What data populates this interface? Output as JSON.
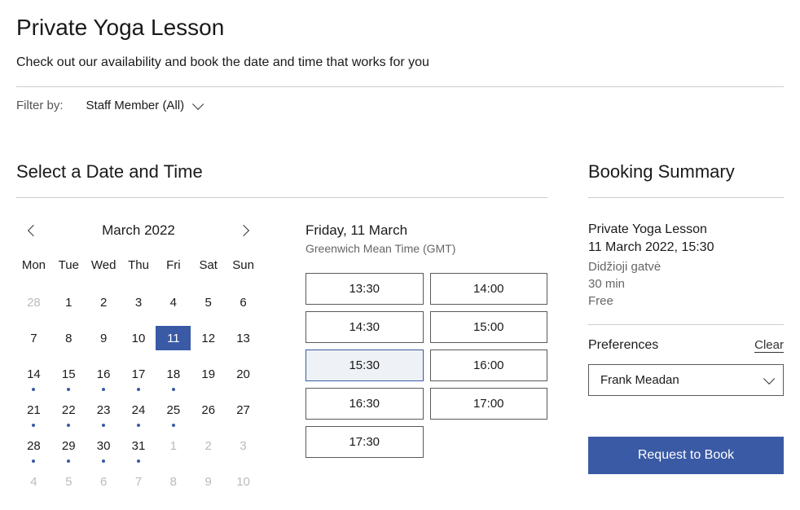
{
  "header": {
    "title": "Private Yoga Lesson",
    "subtitle": "Check out our availability and book the date and time that works for you"
  },
  "filter": {
    "label": "Filter by:",
    "value": "Staff Member (All)"
  },
  "sections": {
    "select_dt": "Select a Date and Time",
    "summary": "Booking Summary"
  },
  "calendar": {
    "month_year": "March  2022",
    "weekdays": [
      "Mon",
      "Tue",
      "Wed",
      "Thu",
      "Fri",
      "Sat",
      "Sun"
    ],
    "days": [
      {
        "n": "28",
        "muted": true
      },
      {
        "n": "1"
      },
      {
        "n": "2"
      },
      {
        "n": "3"
      },
      {
        "n": "4"
      },
      {
        "n": "5"
      },
      {
        "n": "6"
      },
      {
        "n": "7"
      },
      {
        "n": "8"
      },
      {
        "n": "9"
      },
      {
        "n": "10"
      },
      {
        "n": "11",
        "selected": true
      },
      {
        "n": "12"
      },
      {
        "n": "13"
      },
      {
        "n": "14",
        "dot": true
      },
      {
        "n": "15",
        "dot": true
      },
      {
        "n": "16",
        "dot": true
      },
      {
        "n": "17",
        "dot": true
      },
      {
        "n": "18",
        "dot": true
      },
      {
        "n": "19"
      },
      {
        "n": "20"
      },
      {
        "n": "21",
        "dot": true
      },
      {
        "n": "22",
        "dot": true
      },
      {
        "n": "23",
        "dot": true
      },
      {
        "n": "24",
        "dot": true
      },
      {
        "n": "25",
        "dot": true
      },
      {
        "n": "26"
      },
      {
        "n": "27"
      },
      {
        "n": "28",
        "dot": true
      },
      {
        "n": "29",
        "dot": true
      },
      {
        "n": "30",
        "dot": true
      },
      {
        "n": "31",
        "dot": true
      },
      {
        "n": "1",
        "muted": true
      },
      {
        "n": "2",
        "muted": true
      },
      {
        "n": "3",
        "muted": true
      },
      {
        "n": "4",
        "muted": true
      },
      {
        "n": "5",
        "muted": true
      },
      {
        "n": "6",
        "muted": true
      },
      {
        "n": "7",
        "muted": true
      },
      {
        "n": "8",
        "muted": true
      },
      {
        "n": "9",
        "muted": true
      },
      {
        "n": "10",
        "muted": true
      }
    ]
  },
  "times": {
    "heading": "Friday, 11 March",
    "tz": "Greenwich Mean Time (GMT)",
    "slots": [
      {
        "t": "13:30"
      },
      {
        "t": "14:00"
      },
      {
        "t": "14:30"
      },
      {
        "t": "15:00"
      },
      {
        "t": "15:30",
        "selected": true
      },
      {
        "t": "16:00"
      },
      {
        "t": "16:30"
      },
      {
        "t": "17:00"
      },
      {
        "t": "17:30"
      }
    ]
  },
  "summary": {
    "service": "Private Yoga Lesson",
    "datetime": "11 March 2022, 15:30",
    "location": "Didžioji gatvė",
    "duration": "30 min",
    "price": "Free"
  },
  "prefs": {
    "label": "Preferences",
    "clear": "Clear",
    "staff": "Frank Meadan"
  },
  "cta": {
    "book": "Request to Book"
  }
}
